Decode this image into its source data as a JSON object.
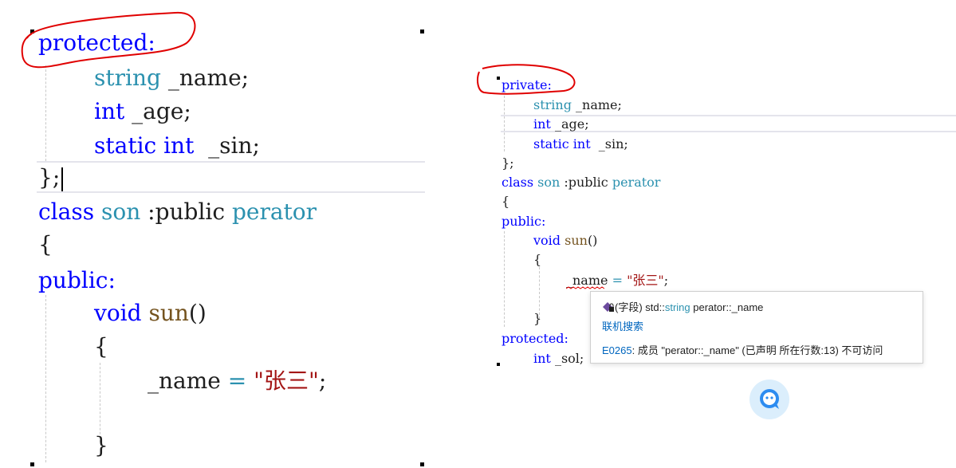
{
  "left_editor": {
    "lines": [
      {
        "k": "protected:"
      },
      {
        "t": "string",
        "i": " _name;"
      },
      {
        "k": "int",
        "i": " _age;"
      },
      {
        "k": "static int",
        "i": "  _sin;"
      },
      {
        "i": "};"
      },
      {
        "k": "class",
        "t": " son",
        "m": " :public",
        "t2": " perator"
      },
      {
        "i": "{"
      },
      {
        "k": "public:"
      },
      {
        "k": "void",
        "f": " sun",
        "i": "()"
      },
      {
        "i": "{"
      },
      {
        "i": "_name",
        "o": " = ",
        "s": "\"张三\"",
        "e": ";"
      },
      {
        "i": "}"
      }
    ]
  },
  "right_editor": {
    "lines": [
      "private:",
      "string _name;",
      "int _age;",
      "static int  _sin;",
      "};",
      "class son :public perator",
      "{",
      "public:",
      "void sun()",
      "{",
      "_name = \"张三\";",
      "}",
      "protected:",
      "int _sol;"
    ]
  },
  "tooltip": {
    "field_prefix": "(字段) std::",
    "field_type": "string",
    "field_rest": " perator::_name",
    "search_link": "联机搜索",
    "error_code": "E0265",
    "error_text": ": 成员 \"perator::_name\" (已声明 所在行数:13) 不可访问"
  },
  "icons": {
    "field_icon": "field-lock-icon",
    "assistant": "assistant-chat-icon"
  },
  "colors": {
    "keyword": "#0000ff",
    "type": "#2b91af",
    "function": "#74531f",
    "string": "#a31515",
    "annotation": "#e00000",
    "link": "#0066bf"
  }
}
